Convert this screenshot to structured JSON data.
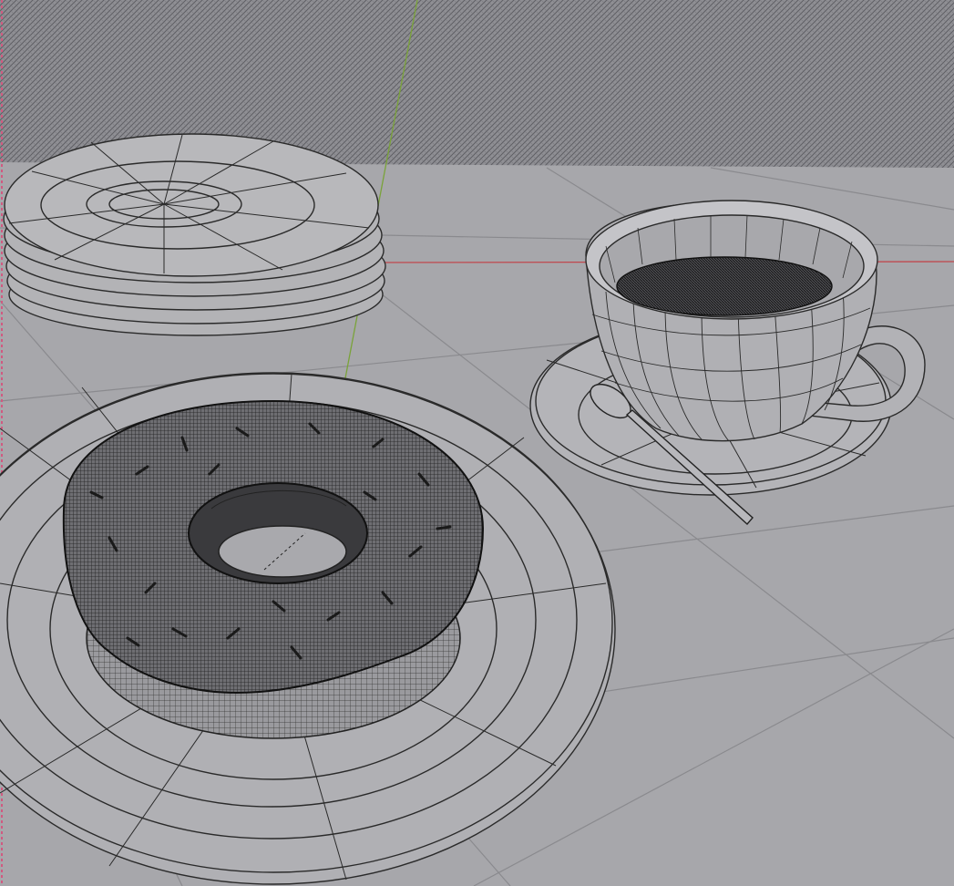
{
  "viewport": {
    "shading_mode": "wireframe",
    "background_color": "#8f8f94",
    "floor_color": "#a7a7ab",
    "grid_line_color": "#8a8a8e",
    "x_axis_color": "#c0484e",
    "y_axis_color": "#7aa33a",
    "selection_border_color": "#d05a80",
    "wire_color": "#2a2a2a",
    "dense_wire_color": "#111111"
  },
  "scene_objects": [
    {
      "name": "plate-stack",
      "icon": "plate-stack-icon"
    },
    {
      "name": "dinner-plate",
      "icon": "plate-icon"
    },
    {
      "name": "donut",
      "icon": "donut-icon"
    },
    {
      "name": "coffee-cup",
      "icon": "cup-icon"
    },
    {
      "name": "saucer",
      "icon": "saucer-icon"
    },
    {
      "name": "spoon",
      "icon": "spoon-icon"
    }
  ]
}
